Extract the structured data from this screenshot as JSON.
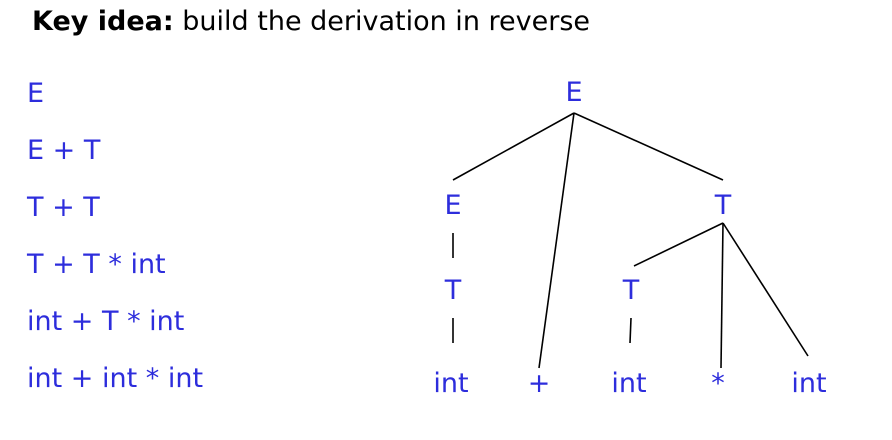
{
  "title": {
    "bold": "Key idea:",
    "rest": "build the derivation in reverse"
  },
  "derivation_steps": [
    "E",
    "E + T",
    "T + T",
    "T + T * int",
    "int + T * int",
    "int + int * int"
  ],
  "tree": {
    "nodes": [
      "E",
      "E",
      "T",
      "T",
      "T",
      "int",
      "+",
      "int",
      "*",
      "int"
    ],
    "edges": [
      [
        0,
        1
      ],
      [
        0,
        6
      ],
      [
        0,
        2
      ],
      [
        1,
        3
      ],
      [
        3,
        5
      ],
      [
        2,
        4
      ],
      [
        2,
        8
      ],
      [
        2,
        9
      ],
      [
        4,
        7
      ]
    ]
  },
  "colors": {
    "symbol": "#2d2ddc",
    "text": "#000000",
    "edge": "#000000"
  }
}
